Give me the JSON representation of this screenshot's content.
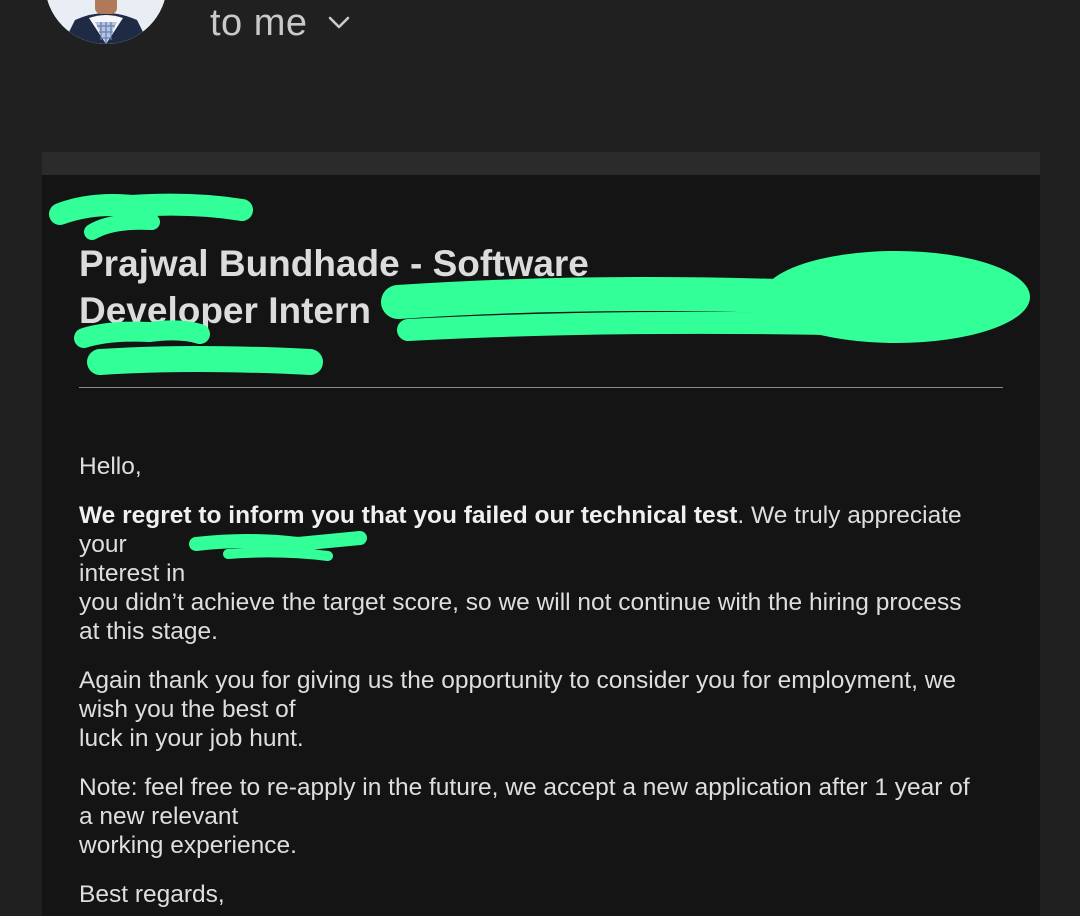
{
  "header": {
    "recipient_label": "to me",
    "details_icon": "chevron-down-icon",
    "avatar_icon": "sender-avatar"
  },
  "email": {
    "subject": {
      "line1": "Prajwal Bundhade - Software",
      "line2": "Developer Intern"
    },
    "greeting": "Hello,",
    "paragraph1": {
      "bold": "We regret to inform you that you failed our technical test",
      "rest": ". We truly appreciate your",
      "line2": "interest in",
      "line3": "you didn’t achieve the target score, so we will not continue with the hiring process",
      "line4": "at this stage."
    },
    "paragraph2": {
      "line1": "Again thank you for giving us the opportunity to consider you for employment, we",
      "line2": "wish you the best of",
      "line3": "luck in your job hunt."
    },
    "paragraph3": {
      "line1": "Note: feel free to re-apply in the future, we accept a new application after 1 year of",
      "line2": "a new relevant",
      "line3": "working experience."
    },
    "signoff": "Best regards,"
  },
  "colors": {
    "background": "#202020",
    "card": "#141414",
    "redaction": "#33ff99",
    "text": "#e6e6e6"
  }
}
